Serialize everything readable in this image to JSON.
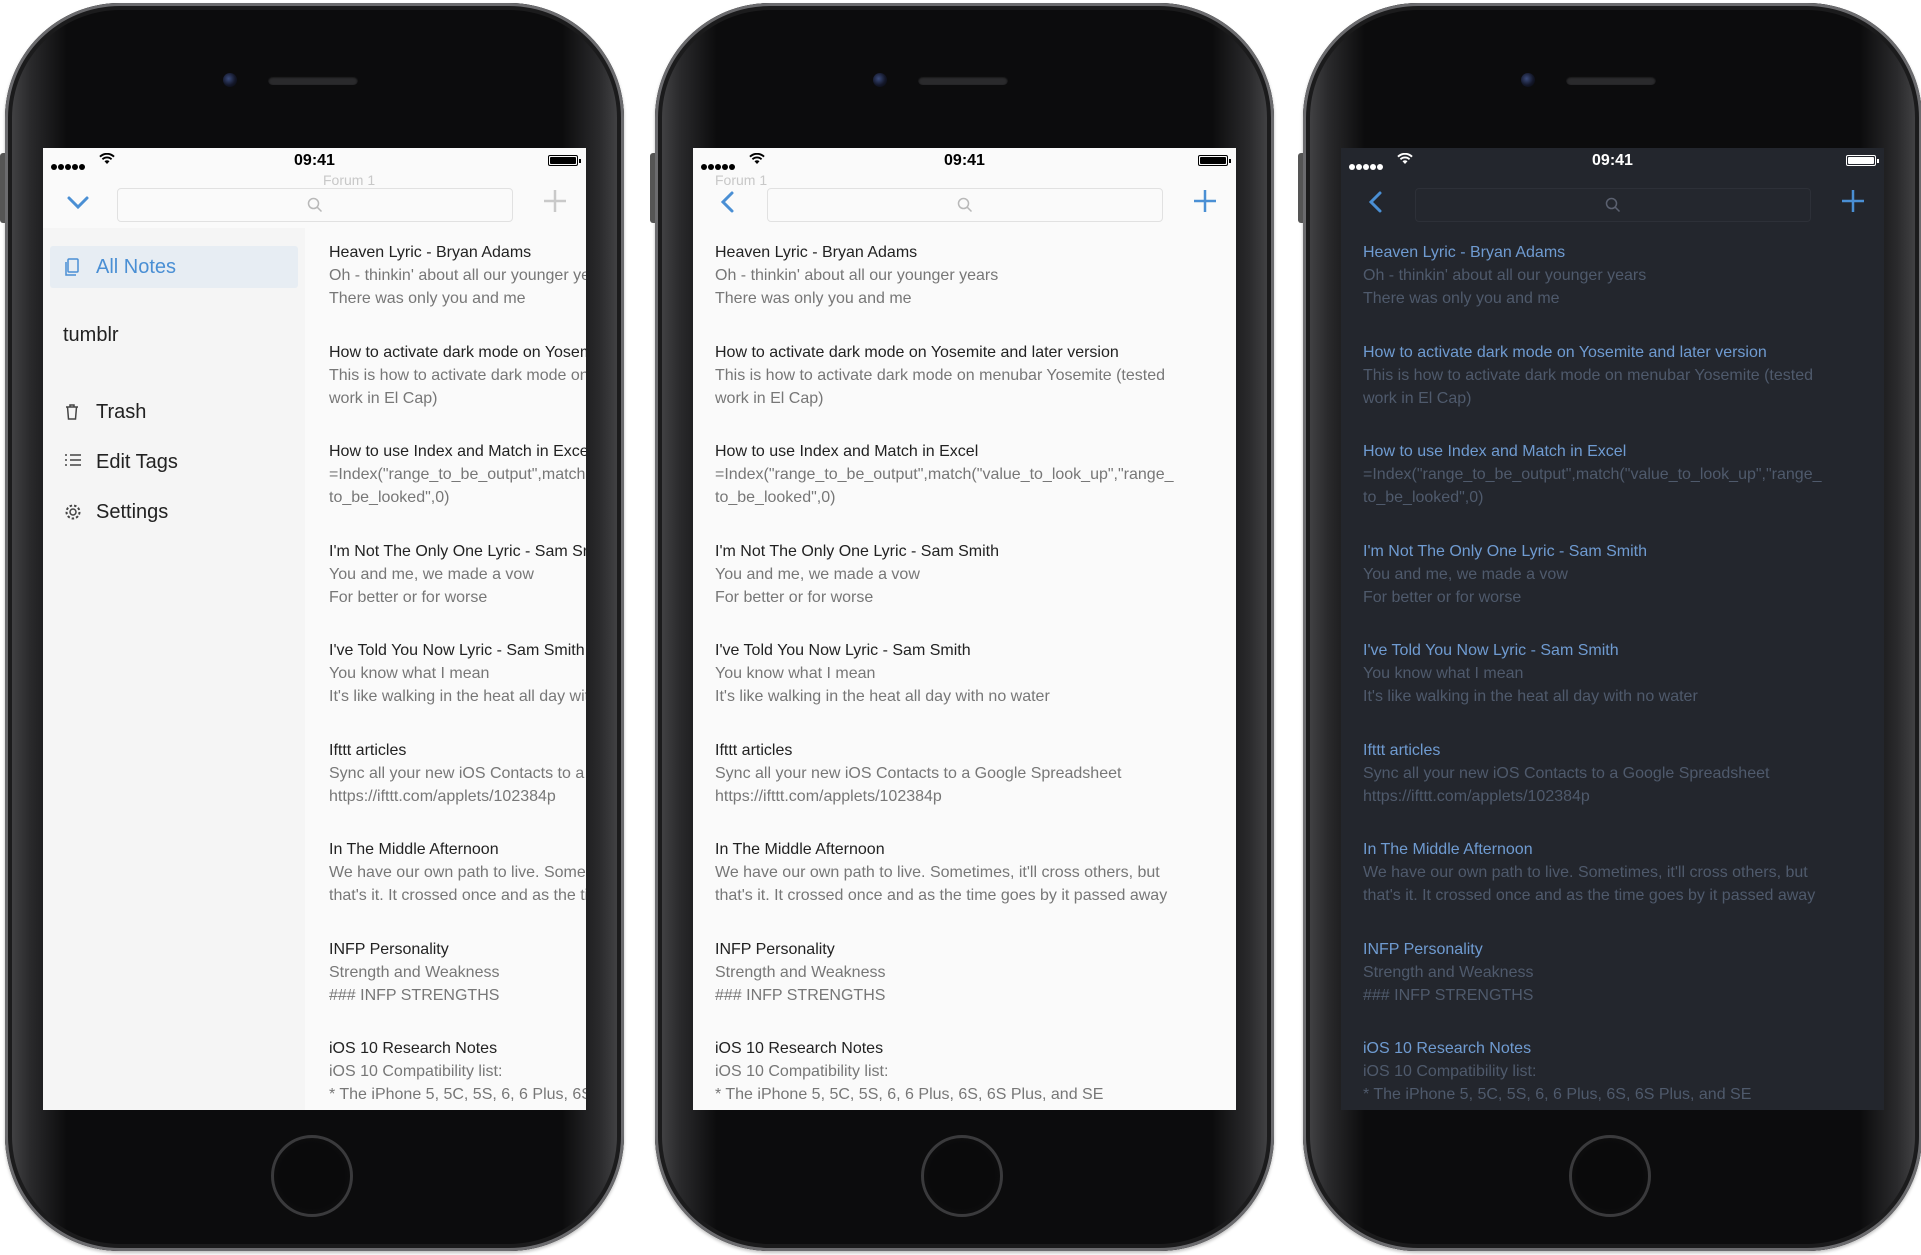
{
  "status_bar": {
    "time": "09:41"
  },
  "sidebar": {
    "all_notes": "All Notes",
    "tumblr": "tumblr",
    "trash": "Trash",
    "edit_tags": "Edit Tags",
    "settings": "Settings"
  },
  "ghost_header": {
    "line1": "",
    "line2": "Forum 1"
  },
  "colors": {
    "accent": "#4a8fd4",
    "dark_bg": "#23262d",
    "dark_title": "#6f9bd1",
    "dark_body": "#4f5a6c"
  },
  "icons": [
    "chevron-down-icon",
    "back-chevron-icon",
    "search-icon",
    "plus-icon",
    "notes-icon",
    "trash-icon",
    "tags-icon",
    "gear-icon"
  ],
  "notes": [
    {
      "title": "Heaven Lyric - Bryan Adams",
      "line1": "Oh - thinkin' about all our younger years",
      "line2": "There was only you and me"
    },
    {
      "title": "How to activate dark mode on Yosemite and later version",
      "line1": "This is how to activate dark mode on menubar Yosemite (tested",
      "line2": "work in El Cap)"
    },
    {
      "title": "How to use Index and Match in Excel",
      "line1": "=Index(\"range_to_be_output\",match(\"value_to_look_up\",\"range_",
      "line2": "to_be_looked\",0)"
    },
    {
      "title": "I'm Not The Only One Lyric - Sam Smith",
      "line1": "You and me, we made a vow",
      "line2": "For better or for worse"
    },
    {
      "title": "I've Told You Now Lyric - Sam Smith",
      "line1": "You know what I mean",
      "line2": "It's like walking in the heat all day with no water"
    },
    {
      "title": "Ifttt articles",
      "line1": "Sync all your new iOS Contacts to a Google Spreadsheet",
      "line2": "https://ifttt.com/applets/102384p"
    },
    {
      "title": "In The Middle Afternoon",
      "line1": "We have our own path to live. Sometimes, it'll cross others, but",
      "line2": "that's it. It crossed once and as the time goes by it passed away"
    },
    {
      "title": "INFP Personality",
      "line1": "Strength and Weakness",
      "line2": "###  INFP STRENGTHS"
    },
    {
      "title": "iOS 10 Research Notes",
      "line1": "iOS 10 Compatibility list:",
      "line2": "* The iPhone 5, 5C, 5S, 6, 6 Plus, 6S, 6S Plus, and SE"
    }
  ]
}
